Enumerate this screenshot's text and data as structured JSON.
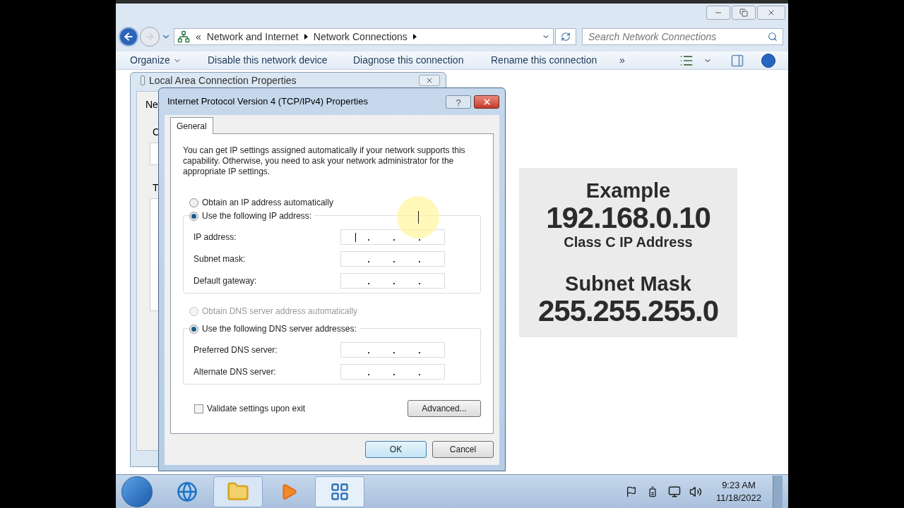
{
  "explorer": {
    "breadcrumb_prefix": "«",
    "breadcrumb": [
      "Network and Internet",
      "Network Connections"
    ],
    "search": {
      "placeholder": "Search Network Connections"
    },
    "commands": [
      "Organize",
      "Disable this network device",
      "Diagnose this connection",
      "Rename this connection"
    ],
    "more": "»"
  },
  "back_dialog": {
    "title": "Local Area Connection Properties",
    "tab": "Ne",
    "fragments": [
      "C",
      "T"
    ]
  },
  "dialog": {
    "title": "Internet Protocol Version 4 (TCP/IPv4) Properties",
    "help": "?",
    "tabs": [
      {
        "label": "General",
        "selected": true
      }
    ],
    "intro": "You can get IP settings assigned automatically if your network supports this capability. Otherwise, you need to ask your network administrator for the appropriate IP settings.",
    "ip_options": [
      {
        "label": "Obtain an IP address automatically",
        "selected": false,
        "disabled": false
      },
      {
        "label": "Use the following IP address:",
        "selected": true,
        "disabled": false
      }
    ],
    "ip_fields": [
      {
        "label": "IP address:",
        "focused": true
      },
      {
        "label": "Subnet mask:",
        "focused": false
      },
      {
        "label": "Default gateway:",
        "focused": false
      }
    ],
    "dns_options": [
      {
        "label": "Obtain DNS server address automatically",
        "selected": false,
        "disabled": true
      },
      {
        "label": "Use the following DNS server addresses:",
        "selected": true,
        "disabled": false
      }
    ],
    "dns_fields": [
      {
        "label": "Preferred DNS server:",
        "focused": false
      },
      {
        "label": "Alternate DNS server:",
        "focused": false
      }
    ],
    "validate": {
      "label": "Validate settings upon exit",
      "checked": false
    },
    "advanced": "Advanced...",
    "buttons": [
      {
        "label": "OK",
        "default": true
      },
      {
        "label": "Cancel",
        "default": false
      }
    ]
  },
  "overlay": {
    "lines": [
      {
        "kind": "heading",
        "text": "Example"
      },
      {
        "kind": "value",
        "text": "192.168.0.10"
      },
      {
        "kind": "caption",
        "text": "Class C IP Address"
      },
      {
        "kind": "heading",
        "text": "Subnet Mask"
      },
      {
        "kind": "value",
        "text": "255.255.255.0"
      }
    ]
  },
  "taskbar": {
    "apps": [
      {
        "kind": "browser",
        "open": false
      },
      {
        "kind": "folder",
        "open": true
      },
      {
        "kind": "media",
        "open": false
      },
      {
        "kind": "network",
        "open": true
      }
    ],
    "time": "9:23 AM",
    "date": "11/18/2022"
  }
}
